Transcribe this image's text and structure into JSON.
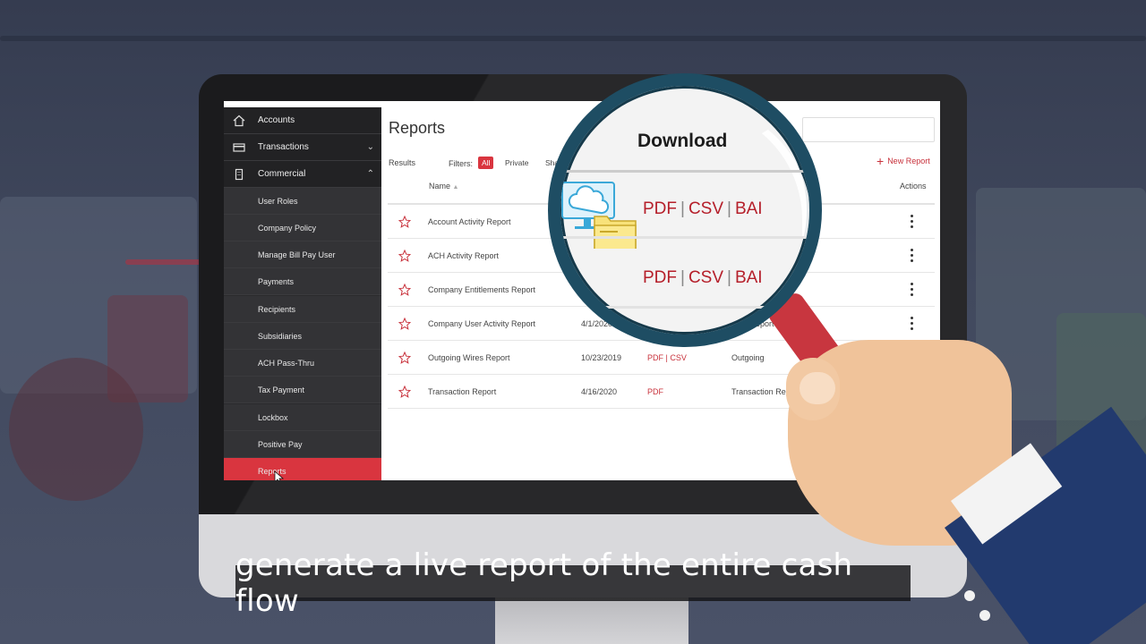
{
  "sidebar": {
    "top_items": [
      {
        "label": "Accounts",
        "icon": "home-icon"
      },
      {
        "label": "Transactions",
        "icon": "card-icon"
      },
      {
        "label": "Commercial",
        "icon": "building-icon"
      }
    ],
    "sub_items": [
      "User Roles",
      "Company Policy",
      "Manage Bill Pay User",
      "Payments",
      "Recipients",
      "Subsidiaries",
      "ACH Pass-Thru",
      "Tax Payment",
      "Lockbox",
      "Positive Pay",
      "Reports"
    ],
    "active_item": "Reports"
  },
  "reports": {
    "title": "Reports",
    "results_label": "Results",
    "filters_label": "Filters:",
    "filters": [
      "All",
      "Private",
      "Shar"
    ],
    "active_filter": "All",
    "new_report_label": "New Report",
    "columns": {
      "name": "Name",
      "actions": "Actions"
    },
    "rows": [
      {
        "name": "Account Activity Report",
        "date": "",
        "formats": "",
        "type": ""
      },
      {
        "name": "ACH Activity Report",
        "date": "",
        "formats": "",
        "type": ""
      },
      {
        "name": "Company Entitlements Report",
        "date": "",
        "formats": "",
        "type": "metns Report"
      },
      {
        "name": "Company User Activity Report",
        "date": "4/1/2020",
        "formats": "",
        "type": "tivity Report"
      },
      {
        "name": "Outgoing Wires Report",
        "date": "10/23/2019",
        "formats": "PDF | CSV",
        "type": "Outgoing"
      },
      {
        "name": "Transaction Report",
        "date": "4/16/2020",
        "formats": "PDF",
        "type": "Transaction Rep"
      }
    ]
  },
  "magnifier": {
    "heading": "Download",
    "format_lines": [
      [
        "PDF",
        "CSV",
        "BAI"
      ],
      [
        "PDF",
        "CSV",
        "BAI"
      ]
    ]
  },
  "caption": "generate a live report of the entire cash flow",
  "colors": {
    "accent": "#d9353f",
    "lens_rim": "#1e4d63",
    "sidebar": "#2a2a2c"
  }
}
